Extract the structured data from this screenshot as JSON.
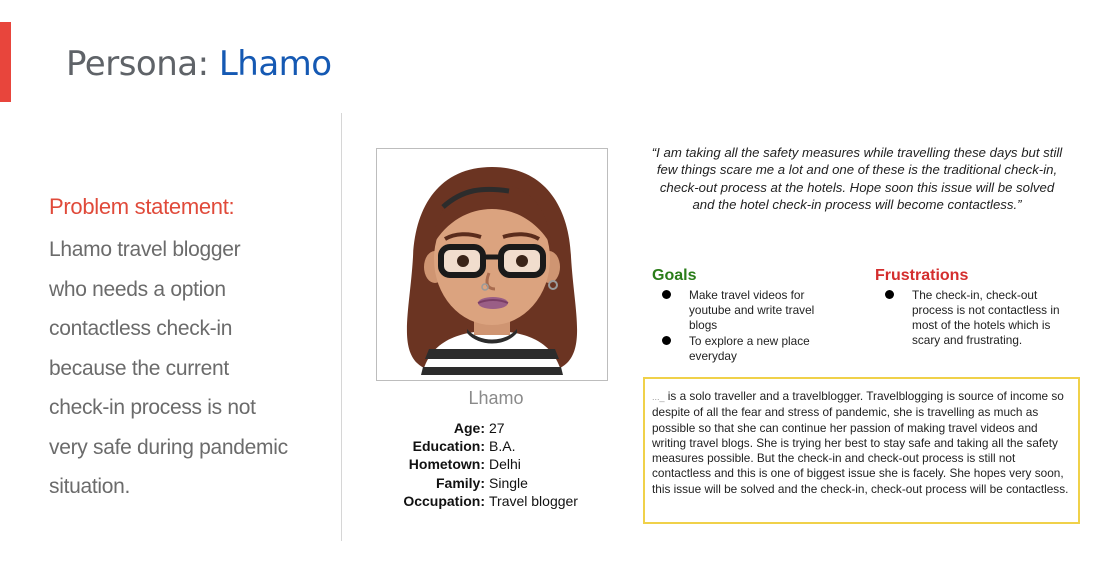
{
  "title": {
    "prefix": "Persona: ",
    "name": "Lhamo"
  },
  "problem": {
    "heading": "Problem statement:",
    "lines": [
      "Lhamo  travel blogger",
      "who needs a option",
      "contactless check-in",
      "because the current",
      "check-in process is not",
      "very safe during pandemic",
      "situation."
    ]
  },
  "persona": {
    "name": "Lhamo",
    "facts": [
      {
        "label": "Age:",
        "value": "27"
      },
      {
        "label": "Education:",
        "value": "B.A."
      },
      {
        "label": "Hometown:",
        "value": "Delhi"
      },
      {
        "label": "Family:",
        "value": "Single"
      },
      {
        "label": "Occupation:",
        "value": "Travel blogger"
      }
    ]
  },
  "quote": "“I am taking all the safety measures while travelling these days but still few things scare me a lot and one of these is the traditional check-in, check-out process at the hotels. Hope soon this issue will be solved and the hotel check-in process will become contactless.”",
  "goals": {
    "title": "Goals",
    "items": [
      "Make travel videos for youtube and write travel blogs",
      "To explore a new place everyday"
    ]
  },
  "frustrations": {
    "title": "Frustrations",
    "items": [
      "The check-in, check-out process is not contactless in most of the hotels which is scary and frustrating."
    ]
  },
  "bio": {
    "prefix": "..._",
    "text": " is a solo traveller and a travelblogger. Travelblogging is source of income so despite of all the fear and stress of pandemic, she is travelling as much as possible so that she can continue her passion of making travel videos and writing travel blogs. She is trying her best to stay safe and taking all the safety measures possible. But the check-in and check-out process is still not contactless and this is one of biggest issue she is facely. She hopes very soon, this issue will be solved and the check-in, check-out process will be contactless."
  },
  "colors": {
    "accent": "#e8453c",
    "title_name": "#1559b3",
    "problem_heading": "#e04a3a",
    "goals": "#2a7d19",
    "frustrations": "#d42e2e",
    "bio_border": "#f0d14a"
  }
}
